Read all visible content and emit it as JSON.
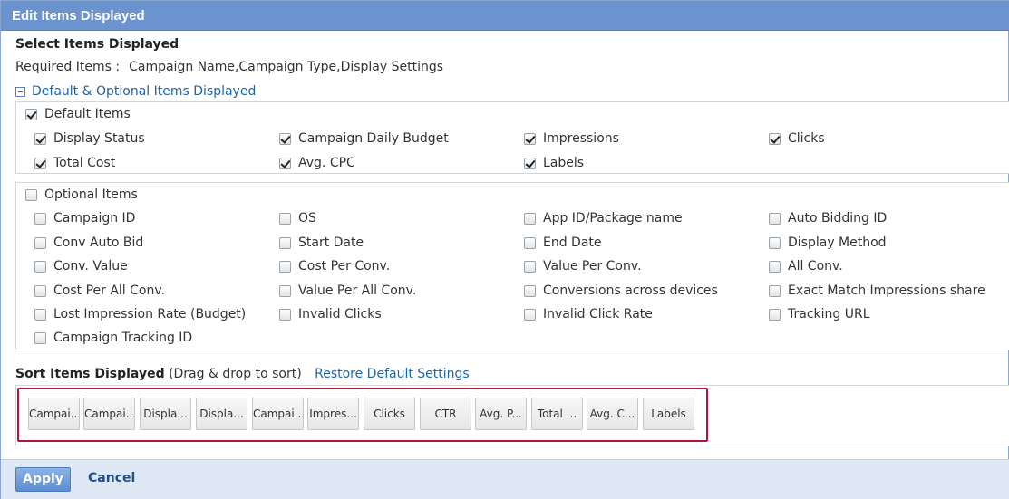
{
  "dialog": {
    "title": "Edit Items Displayed",
    "section_title": "Select Items Displayed",
    "required_label": "Required Items :",
    "required_value": "Campaign Name,Campaign Type,Display Settings",
    "toggle_label": "Default & Optional Items Displayed",
    "toggle_icon": "minus-box-icon"
  },
  "default_group": {
    "label": "Default Items",
    "checked": true,
    "items": [
      {
        "label": "Display Status",
        "checked": true
      },
      {
        "label": "Campaign Daily Budget",
        "checked": true
      },
      {
        "label": "Impressions",
        "checked": true
      },
      {
        "label": "Clicks",
        "checked": true
      },
      {
        "label": "Total Cost",
        "checked": true
      },
      {
        "label": "Avg. CPC",
        "checked": true
      },
      {
        "label": "Labels",
        "checked": true
      }
    ]
  },
  "optional_group": {
    "label": "Optional Items",
    "checked": false,
    "items": [
      {
        "label": "Campaign ID",
        "checked": false
      },
      {
        "label": "OS",
        "checked": false
      },
      {
        "label": "App ID/Package name",
        "checked": false
      },
      {
        "label": "Auto Bidding ID",
        "checked": false
      },
      {
        "label": "Conv Auto Bid",
        "checked": false
      },
      {
        "label": "Start Date",
        "checked": false
      },
      {
        "label": "End Date",
        "checked": false
      },
      {
        "label": "Display Method",
        "checked": false
      },
      {
        "label": "Conv. Value",
        "checked": false
      },
      {
        "label": "Cost Per Conv.",
        "checked": false
      },
      {
        "label": "Value Per Conv.",
        "checked": false
      },
      {
        "label": "All Conv.",
        "checked": false
      },
      {
        "label": "Cost Per All Conv.",
        "checked": false
      },
      {
        "label": "Value Per All Conv.",
        "checked": false
      },
      {
        "label": "Conversions across devices",
        "checked": false
      },
      {
        "label": "Exact Match Impressions share",
        "checked": false
      },
      {
        "label": "Lost Impression Rate (Budget)",
        "checked": false
      },
      {
        "label": "Invalid Clicks",
        "checked": false
      },
      {
        "label": "Invalid Click Rate",
        "checked": false
      },
      {
        "label": "Tracking URL",
        "checked": false
      },
      {
        "label": "Campaign Tracking ID",
        "checked": false
      }
    ]
  },
  "sort": {
    "title": "Sort Items Displayed",
    "hint": "(Drag & drop to sort)",
    "restore_label": "Restore Default Settings",
    "chips": [
      "Campai...",
      "Campai...",
      "Displa...",
      "Displa...",
      "Campai...",
      "Impres...",
      "Clicks",
      "CTR",
      "Avg. P...",
      "Total ...",
      "Avg. C...",
      "Labels"
    ],
    "highlight_color": "#b0143c"
  },
  "footer": {
    "apply_label": "Apply",
    "cancel_label": "Cancel"
  },
  "colors": {
    "titlebar": "#6b93cf",
    "link": "#1e64a8",
    "footer": "#dfe8f5"
  }
}
